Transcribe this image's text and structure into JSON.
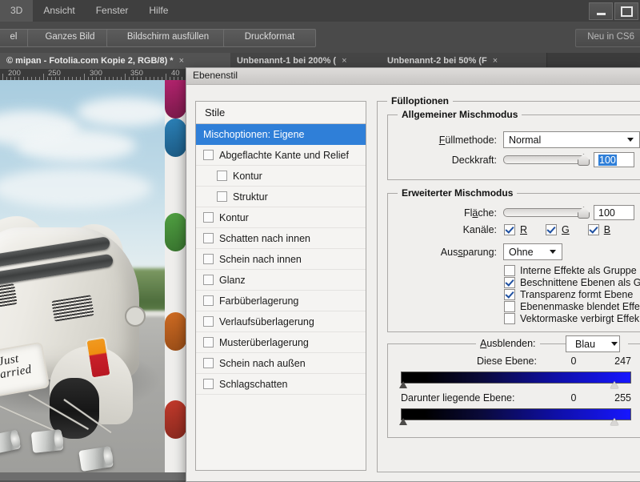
{
  "app": {
    "menus": [
      "3D",
      "Ansicht",
      "Fenster",
      "Hilfe"
    ],
    "window_buttons": {
      "minimize": "minimize-button",
      "maximize": "maximize-button"
    }
  },
  "options_bar": {
    "buttons": [
      "el",
      "Ganzes Bild",
      "Bildschirm ausfüllen",
      "Druckformat"
    ],
    "right_label": "Neu in CS6"
  },
  "tabs": [
    {
      "label": "© mipan - Fotolia.com Kopie 2, RGB/8) *",
      "close": "×",
      "active": true
    },
    {
      "label": "Unbenannt-1 bei 200% (",
      "close": "×",
      "active": false
    },
    {
      "label": "Unbenannt-2 bei 50% (F",
      "close": "×",
      "active": false
    }
  ],
  "ruler": {
    "labels": [
      "200",
      "250",
      "300",
      "350",
      "40"
    ]
  },
  "photo": {
    "plate_line1": "Just",
    "plate_line2": "Married"
  },
  "dialog": {
    "title": "Ebenenstil",
    "styles": {
      "header": "Stile",
      "items": [
        {
          "label": "Mischoptionen: Eigene",
          "checkbox": false,
          "selected": true,
          "indent": false
        },
        {
          "label": "Abgeflachte Kante und Relief",
          "checkbox": true,
          "selected": false,
          "indent": false
        },
        {
          "label": "Kontur",
          "checkbox": true,
          "selected": false,
          "indent": true
        },
        {
          "label": "Struktur",
          "checkbox": true,
          "selected": false,
          "indent": true
        },
        {
          "label": "Kontur",
          "checkbox": true,
          "selected": false,
          "indent": false
        },
        {
          "label": "Schatten nach innen",
          "checkbox": true,
          "selected": false,
          "indent": false
        },
        {
          "label": "Schein nach innen",
          "checkbox": true,
          "selected": false,
          "indent": false
        },
        {
          "label": "Glanz",
          "checkbox": true,
          "selected": false,
          "indent": false
        },
        {
          "label": "Farbüberlagerung",
          "checkbox": true,
          "selected": false,
          "indent": false
        },
        {
          "label": "Verlaufsüberlagerung",
          "checkbox": true,
          "selected": false,
          "indent": false
        },
        {
          "label": "Musterüberlagerung",
          "checkbox": true,
          "selected": false,
          "indent": false
        },
        {
          "label": "Schein nach außen",
          "checkbox": true,
          "selected": false,
          "indent": false
        },
        {
          "label": "Schlagschatten",
          "checkbox": true,
          "selected": false,
          "indent": false
        }
      ]
    },
    "fill_options": {
      "legend": "Fülloptionen",
      "general": {
        "legend": "Allgemeiner Mischmodus",
        "blend_mode_label": "Füllmethode:",
        "blend_mode_value": "Normal",
        "opacity_label": "Deckkraft:",
        "opacity_value": "100"
      },
      "advanced": {
        "legend": "Erweiterter Mischmodus",
        "fill_label": "Fläche:",
        "fill_value": "100",
        "channels_label": "Kanäle:",
        "channels": [
          {
            "label": "R",
            "checked": true
          },
          {
            "label": "G",
            "checked": true
          },
          {
            "label": "B",
            "checked": true
          }
        ],
        "knockout_label": "Aussparung:",
        "knockout_value": "Ohne",
        "checkboxes": [
          {
            "label": "Interne Effekte als Gruppe",
            "checked": false
          },
          {
            "label": "Beschnittene Ebenen als G",
            "checked": true
          },
          {
            "label": "Transparenz formt Ebene",
            "checked": true
          },
          {
            "label": "Ebenenmaske blendet Effe",
            "checked": false
          },
          {
            "label": "Vektormaske verbirgt Effek",
            "checked": false
          }
        ]
      },
      "blend_if": {
        "legend_label": "Ausblenden:",
        "channel_value": "Blau",
        "this_layer_label": "Diese Ebene:",
        "this_layer_min": "0",
        "this_layer_max": "247",
        "under_layer_label": "Darunter liegende Ebene:",
        "under_layer_min": "0",
        "under_layer_max": "255"
      }
    }
  },
  "colors": {
    "accent": "#2f7fd8",
    "dialog_bg": "#f0efed",
    "app_bg": "#535353",
    "gradient_end": "#1717ff"
  }
}
